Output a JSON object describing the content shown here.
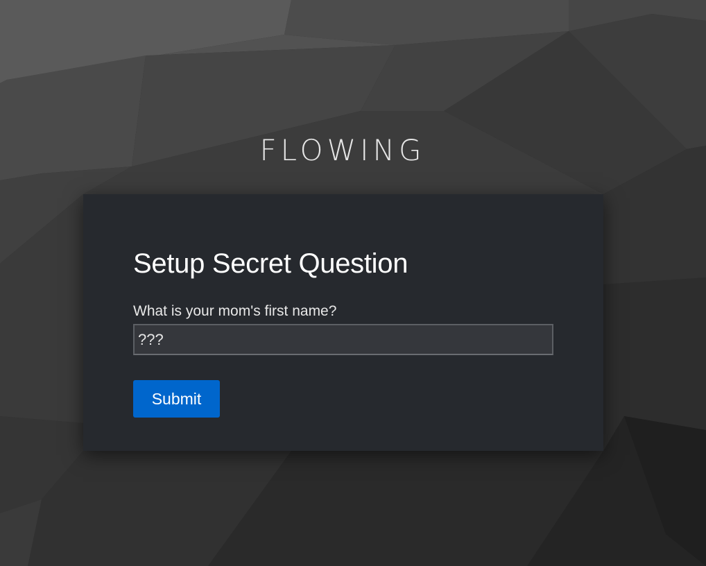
{
  "brand": {
    "name": "FLOWING"
  },
  "form": {
    "title": "Setup Secret Question",
    "question_label": "What is your mom's first name?",
    "answer_value": "???",
    "submit_label": "Submit"
  },
  "colors": {
    "card_background": "#26292e",
    "submit_button": "#0066cc",
    "input_background": "#35373c",
    "page_background": "#2b2b2b"
  }
}
